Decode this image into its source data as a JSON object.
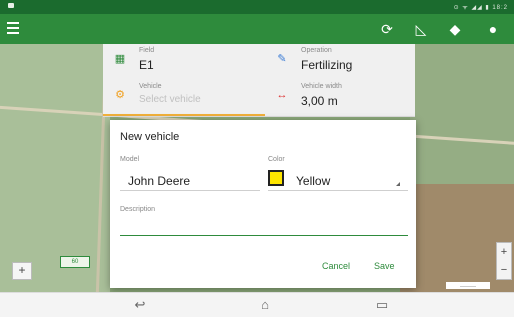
{
  "status_bar": {
    "right_text": "⊙ ᯤ ◢◢ ▮ 18:2"
  },
  "app_bar": {
    "tools": [
      {
        "name": "sync-icon",
        "glyph": "⟳"
      },
      {
        "name": "measure-icon",
        "glyph": "◺"
      },
      {
        "name": "layers-icon",
        "glyph": "◆"
      },
      {
        "name": "account-icon",
        "glyph": "●"
      }
    ]
  },
  "info": {
    "field": {
      "label": "Field",
      "value": "E1"
    },
    "operation": {
      "label": "Operation",
      "value": "Fertilizing"
    },
    "vehicle": {
      "label": "Vehicle",
      "placeholder": "Select vehicle"
    },
    "vehicle_width": {
      "label": "Vehicle width",
      "value": "3,00 m"
    }
  },
  "dialog": {
    "title": "New vehicle",
    "model": {
      "label": "Model",
      "value": "John Deere"
    },
    "color": {
      "label": "Color",
      "value": "Yellow",
      "swatch": "#ffe600"
    },
    "description": {
      "label": "Description",
      "value": ""
    },
    "cancel_label": "Cancel",
    "save_label": "Save"
  },
  "map": {
    "left_button": "+",
    "marker_label": "60",
    "zoom_in": "+",
    "zoom_out": "−",
    "scale_text": "————"
  },
  "nav_bar": {
    "back_glyph": "↩",
    "home_glyph": "⌂",
    "recents_glyph": "▭"
  },
  "colors": {
    "app_bar": "#2e8b3c",
    "accent": "#2e8b3c",
    "swatch": "#ffe600"
  }
}
